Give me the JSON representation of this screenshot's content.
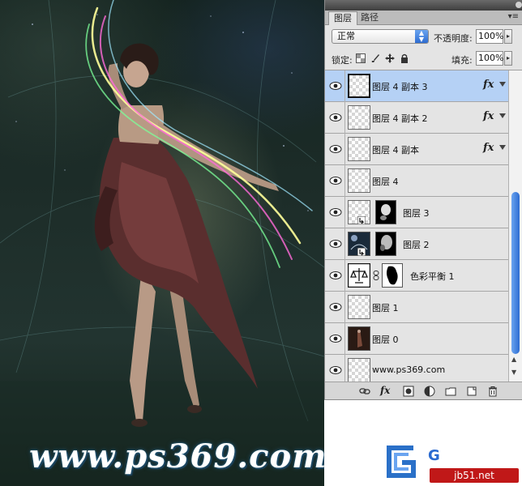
{
  "panel": {
    "tabs": [
      {
        "label": "图层",
        "active": true
      },
      {
        "label": "路径",
        "active": false
      }
    ],
    "blend_mode": "正常",
    "opacity_label": "不透明度:",
    "opacity_value": "100%",
    "lock_label": "锁定:",
    "fill_label": "填充:",
    "fill_value": "100%"
  },
  "layers": [
    {
      "name": "图层 4 副本 3",
      "visible": true,
      "fx": true,
      "selected": true
    },
    {
      "name": "图层 4 副本 2",
      "visible": true,
      "fx": true,
      "selected": false
    },
    {
      "name": "图层 4 副本",
      "visible": true,
      "fx": true,
      "selected": false
    },
    {
      "name": "图层 4",
      "visible": true,
      "fx": false,
      "selected": false
    },
    {
      "name": "图层 3",
      "visible": true,
      "fx": false,
      "selected": false,
      "has_mask": true
    },
    {
      "name": "图层 2",
      "visible": true,
      "fx": false,
      "selected": false,
      "has_mask": true
    },
    {
      "name": "色彩平衡 1",
      "visible": true,
      "fx": false,
      "selected": false,
      "adjustment": true
    },
    {
      "name": "图层 1",
      "visible": true,
      "fx": false,
      "selected": false
    },
    {
      "name": "图层 0",
      "visible": true,
      "fx": false,
      "selected": false,
      "photo": true
    },
    {
      "name": "www.ps369.com",
      "visible": true,
      "fx": false,
      "selected": false
    }
  ],
  "fx_label": "fx",
  "watermark": "www.ps369.com",
  "logo": {
    "text": "G",
    "sub": "jb51.net"
  },
  "colors": {
    "selected_row": "#b5d1f5",
    "accent": "#2d6cd1"
  }
}
